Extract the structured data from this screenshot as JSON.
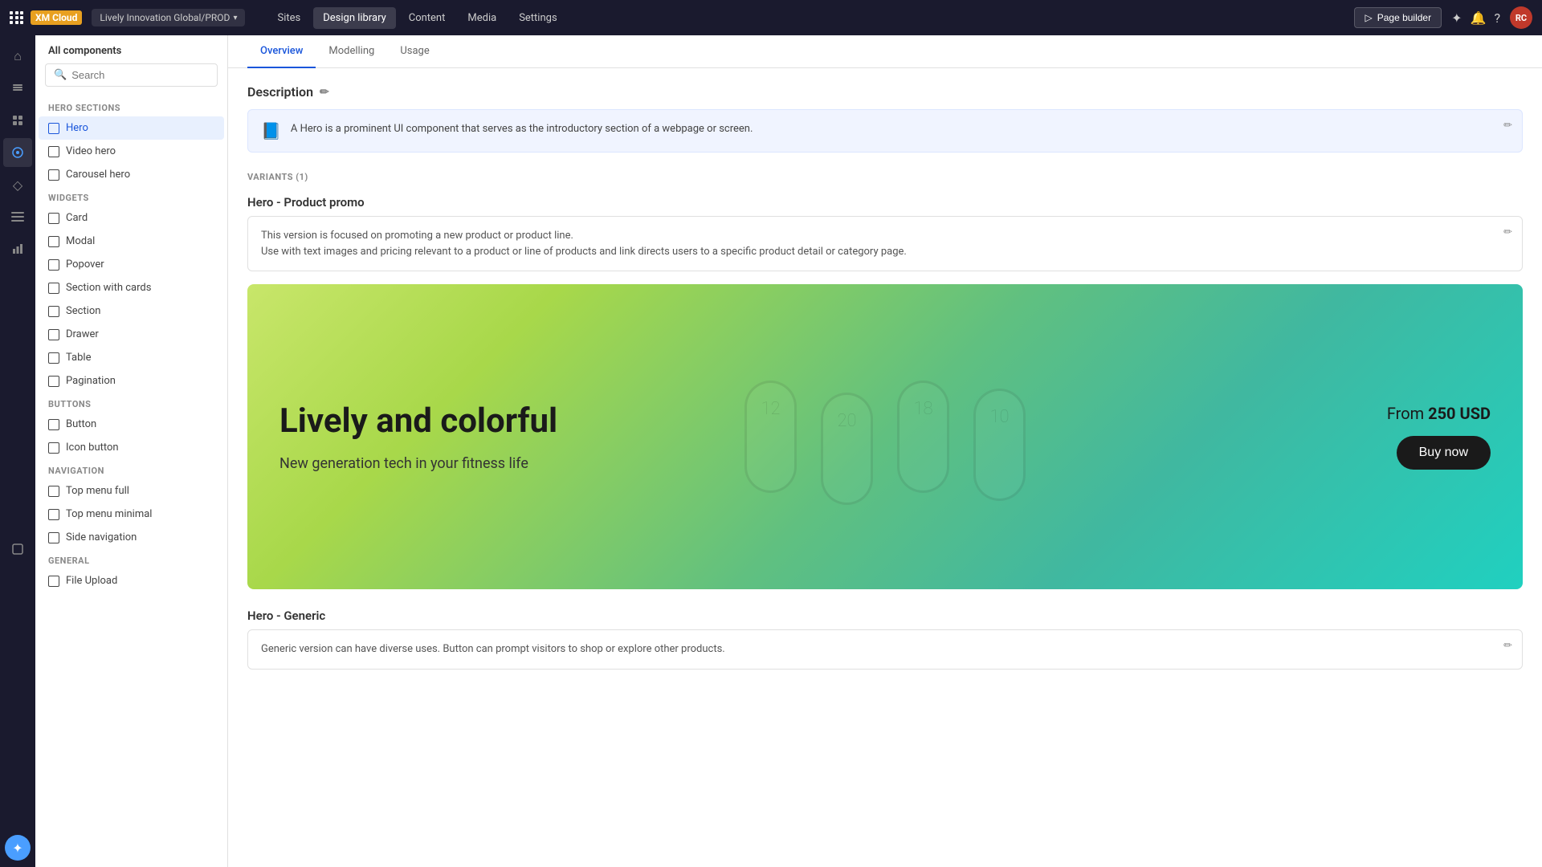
{
  "topbar": {
    "grid_icon": "grid",
    "xm_label": "XM Cloud",
    "env_label": "Lively Innovation Global/PROD",
    "nav_items": [
      {
        "label": "Sites",
        "active": false
      },
      {
        "label": "Design library",
        "active": true
      },
      {
        "label": "Content",
        "active": false
      },
      {
        "label": "Media",
        "active": false
      },
      {
        "label": "Settings",
        "active": false
      }
    ],
    "page_builder_label": "Page builder",
    "avatar_text": "RC"
  },
  "sidebar": {
    "header": "All components",
    "search_placeholder": "Search",
    "sections": [
      {
        "label": "HERO SECTIONS",
        "items": [
          {
            "id": "hero",
            "label": "Hero",
            "active": true
          },
          {
            "id": "video-hero",
            "label": "Video hero",
            "active": false
          },
          {
            "id": "carousel-hero",
            "label": "Carousel hero",
            "active": false
          }
        ]
      },
      {
        "label": "WIDGETS",
        "items": [
          {
            "id": "card",
            "label": "Card",
            "active": false
          },
          {
            "id": "modal",
            "label": "Modal",
            "active": false
          },
          {
            "id": "popover",
            "label": "Popover",
            "active": false
          },
          {
            "id": "section-with-cards",
            "label": "Section with cards",
            "active": false
          },
          {
            "id": "section",
            "label": "Section",
            "active": false
          },
          {
            "id": "drawer",
            "label": "Drawer",
            "active": false
          },
          {
            "id": "table",
            "label": "Table",
            "active": false
          },
          {
            "id": "pagination",
            "label": "Pagination",
            "active": false
          }
        ]
      },
      {
        "label": "BUTTONS",
        "items": [
          {
            "id": "button",
            "label": "Button",
            "active": false
          },
          {
            "id": "icon-button",
            "label": "Icon button",
            "active": false
          }
        ]
      },
      {
        "label": "NAVIGATION",
        "items": [
          {
            "id": "top-menu-full",
            "label": "Top menu full",
            "active": false
          },
          {
            "id": "top-menu-minimal",
            "label": "Top menu minimal",
            "active": false
          },
          {
            "id": "side-navigation",
            "label": "Side navigation",
            "active": false
          }
        ]
      },
      {
        "label": "GENERAL",
        "items": [
          {
            "id": "file-upload",
            "label": "File Upload",
            "active": false
          }
        ]
      }
    ]
  },
  "tabs": [
    {
      "label": "Overview",
      "active": true
    },
    {
      "label": "Modelling",
      "active": false
    },
    {
      "label": "Usage",
      "active": false
    }
  ],
  "main": {
    "description_section": {
      "title": "Description",
      "icon": "📘",
      "text": "A Hero is a prominent UI component that serves as the introductory section of a webpage or screen."
    },
    "variants_label": "VARIANTS (1)",
    "variant_product_promo": {
      "title": "Hero -  Product promo",
      "description_line1": "This version is focused on promoting a new product or product line.",
      "description_line2": "Use with text images and pricing relevant to a product or line of products and link directs users to a specific product detail or category page."
    },
    "hero_preview": {
      "heading": "Lively and colorful",
      "subheading": "New generation tech in your fitness life",
      "price_prefix": "From",
      "price": "250 USD",
      "cta_label": "Buy now",
      "devices": [
        {
          "time": "12"
        },
        {
          "time": "20"
        },
        {
          "time": "18"
        },
        {
          "time": "10"
        }
      ]
    },
    "hero_generic": {
      "title": "Hero - Generic",
      "description": "Generic version can have diverse uses. Button can prompt visitors to shop or explore other products."
    }
  },
  "icon_bar": {
    "icons": [
      {
        "name": "home-icon",
        "symbol": "⌂",
        "active": false
      },
      {
        "name": "layers-icon",
        "symbol": "⊞",
        "active": false
      },
      {
        "name": "grid-icon",
        "symbol": "⊡",
        "active": false
      },
      {
        "name": "palette-icon",
        "symbol": "◈",
        "active": true
      },
      {
        "name": "diamond-icon",
        "symbol": "◇",
        "active": false
      },
      {
        "name": "list-icon",
        "symbol": "≡",
        "active": false
      },
      {
        "name": "chart-icon",
        "symbol": "▤",
        "active": false
      },
      {
        "name": "box-icon",
        "symbol": "▣",
        "active": false
      }
    ]
  }
}
